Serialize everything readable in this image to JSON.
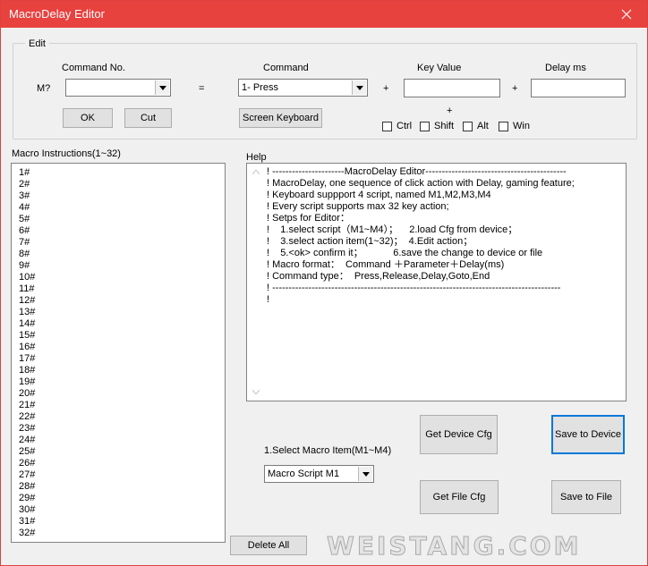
{
  "window": {
    "title": "MacroDelay Editor"
  },
  "edit": {
    "group_title": "Edit",
    "command_no_label": "Command No.",
    "m_label": "M?",
    "command_no_value": "",
    "equals": "=",
    "command_label": "Command",
    "command_value": "1- Press",
    "plus1": "+",
    "key_value_label": "Key Value",
    "key_value": "",
    "plus2": "+",
    "delay_label": "Delay ms",
    "delay_value": "",
    "ok_label": "OK",
    "cut_label": "Cut",
    "screen_keyboard_label": "Screen Keyboard",
    "mod_plus": "+",
    "modifiers": {
      "ctrl": "Ctrl",
      "shift": "Shift",
      "alt": "Alt",
      "win": "Win"
    }
  },
  "macro": {
    "label": "Macro Instructions(1~32)",
    "items": [
      "1#",
      "2#",
      "3#",
      "4#",
      "5#",
      "6#",
      "7#",
      "8#",
      "9#",
      "10#",
      "11#",
      "12#",
      "13#",
      "14#",
      "15#",
      "16#",
      "17#",
      "18#",
      "19#",
      "20#",
      "21#",
      "22#",
      "23#",
      "24#",
      "25#",
      "26#",
      "27#",
      "28#",
      "29#",
      "30#",
      "31#",
      "32#"
    ]
  },
  "help": {
    "label": "Help",
    "lines": [
      "! ----------------------MacroDelay Editor-------------------------------------------",
      "! MacroDelay, one sequence of click action with Delay, gaming feature;",
      "! Keyboard suppport 4 script, named M1,M2,M3,M4",
      "! Every script supports max 32 key action;",
      "! Setps for Editor：",
      "!    1.select script（M1~M4）；    2.load Cfg from device；",
      "!    3.select action item(1~32)；  4.Edit action；",
      "!    5.<ok> confirm it；           6.save the change to device or file",
      "! Macro format：  Command ＋Parameter＋Delay(ms)",
      "! Command type：  Press,Release,Delay,Goto,End",
      "! ----------------------------------------------------------------------------------------",
      "!"
    ]
  },
  "select": {
    "label": "1.Select Macro Item(M1~M4)",
    "value": "Macro Script M1"
  },
  "buttons": {
    "get_device_cfg": "Get Device Cfg",
    "save_to_device": "Save to Device",
    "get_file_cfg": "Get File Cfg",
    "save_to_file": "Save to File",
    "delete_all": "Delete All"
  },
  "watermark": "WEISTANG.COM"
}
